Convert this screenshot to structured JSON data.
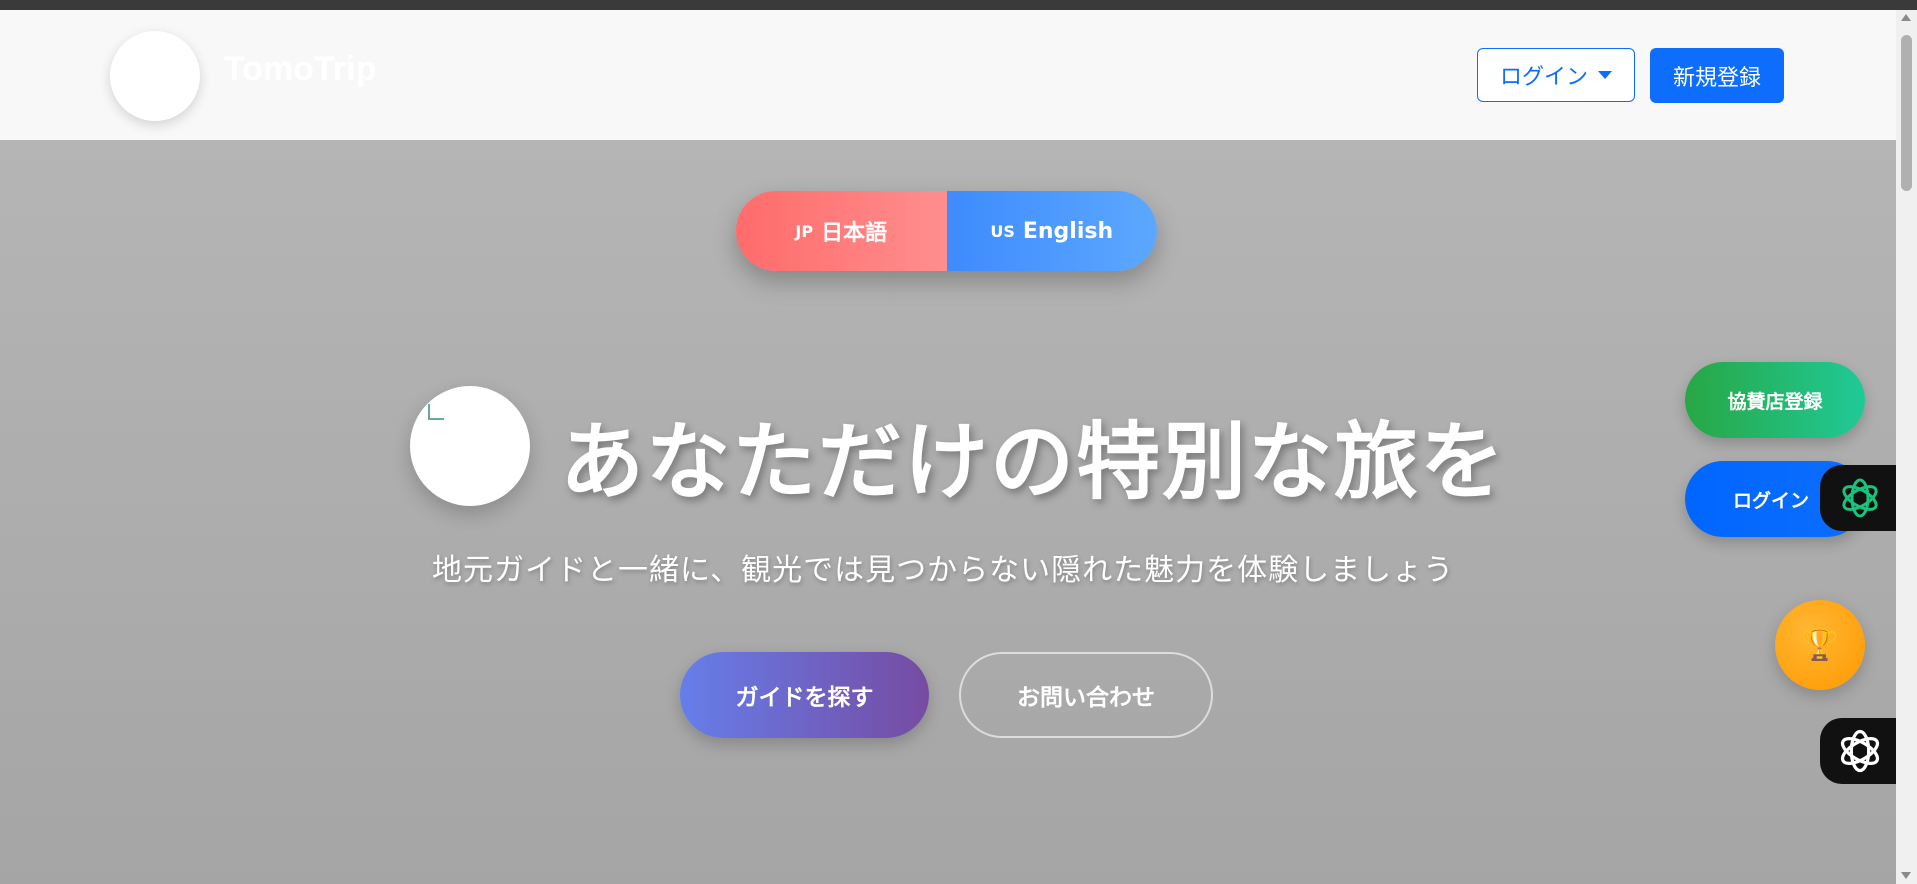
{
  "header": {
    "brand": "TomoTrip",
    "login_label": "ログイン",
    "register_label": "新規登録"
  },
  "language": {
    "jp_flag": "JP",
    "jp_label": "日本語",
    "en_flag": "US",
    "en_label": "English"
  },
  "hero": {
    "headline": "あなただけの特別な旅を",
    "subtitle": "地元ガイドと一緒に、観光では見つからない隠れた魅力を体験しましょう",
    "find_guide_label": "ガイドを探す",
    "contact_label": "お問い合わせ"
  },
  "side": {
    "sponsor_label": "協賛店登録",
    "login_label": "ログイン",
    "trophy_icon": "trophy-icon",
    "ai_icon": "openai-icon"
  },
  "colors": {
    "primary": "#0d6efd",
    "jp_red": "#ff6b6b",
    "en_blue": "#3d8bfd",
    "sponsor_green": "#28a745",
    "trophy_orange": "#ff9800"
  }
}
